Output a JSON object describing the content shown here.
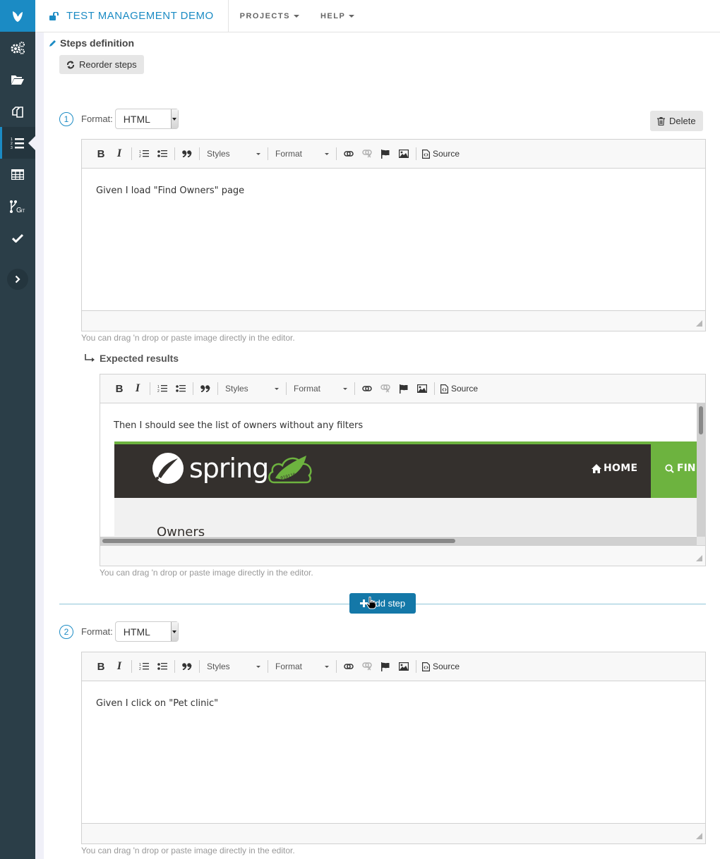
{
  "app": {
    "title": "TEST MANAGEMENT DEMO",
    "menus": [
      {
        "label": "PROJECTS"
      },
      {
        "label": "HELP"
      }
    ]
  },
  "sidebar": {
    "items": [
      {
        "icon": "gears-icon",
        "label": "Settings"
      },
      {
        "icon": "folder-open-icon",
        "label": "Projects"
      },
      {
        "icon": "copy-icon",
        "label": "Test cases"
      },
      {
        "icon": "ordered-list-icon",
        "label": "Steps",
        "active": true
      },
      {
        "icon": "table-icon",
        "label": "Table"
      },
      {
        "icon": "git-icon",
        "label": "Git"
      },
      {
        "icon": "check-icon",
        "label": "Validation"
      }
    ],
    "expand_icon": "chevron-right-icon"
  },
  "section": {
    "title": "Steps definition",
    "reorder_label": "Reorder steps",
    "delete_label": "Delete",
    "format_label": "Format:",
    "add_step_label": "Add step",
    "expected_results_label": "Expected results",
    "hint": "You can drag 'n drop or paste image directly in the editor."
  },
  "toolbar": {
    "styles_label": "Styles",
    "format_label": "Format",
    "source_label": "Source"
  },
  "steps": [
    {
      "number": "1",
      "format": "HTML",
      "action": "Given I load \"Find Owners\" page",
      "expected": {
        "text": "Then I should see the list of owners without any filters",
        "image": {
          "brand": "spring",
          "nav_home": "HOME",
          "nav_find": "FIN",
          "heading": "Owners"
        }
      }
    },
    {
      "number": "2",
      "format": "HTML",
      "action": "Given I click on \"Pet clinic\""
    }
  ],
  "colors": {
    "accent": "#1b8bc4",
    "sidebar": "#2b3e48",
    "add_step_button": "#1478a8",
    "spring_green": "#6db33f",
    "spring_dark": "#34302d"
  }
}
